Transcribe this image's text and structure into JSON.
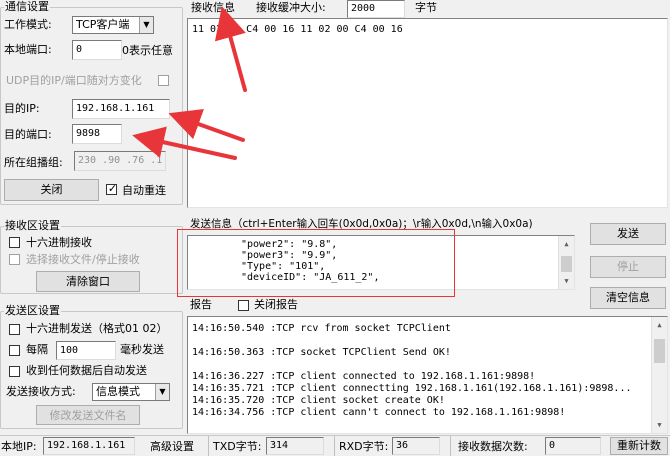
{
  "comm_settings": {
    "title": "通信设置",
    "work_mode_label": "工作模式:",
    "work_mode_value": "TCP客户端",
    "local_port_label": "本地端口:",
    "local_port_value": "0",
    "local_port_hint": "0表示任意",
    "udp_follow_label": "UDP目的IP/端口随对方变化",
    "dest_ip_label": "目的IP:",
    "dest_ip_value": "192.168.1.161",
    "dest_port_label": "目的端口:",
    "dest_port_value": "9898",
    "multicast_label": "所在组播组:",
    "multicast_value": "230 .90 .76 .1",
    "close_button": "关闭",
    "auto_reconnect_label": "自动重连",
    "auto_reconnect_checked": true
  },
  "receive_area": {
    "title": "接收区设置",
    "hex_receive_label": "十六进制接收",
    "select_file_label": "选择接收文件/停止接收",
    "clear_window_button": "清除窗口"
  },
  "send_area": {
    "title": "发送区设置",
    "hex_send_label": "十六进制发送（格式01 02）",
    "every_label": "每隔",
    "interval_value": "100",
    "ms_send_label": "毫秒发送",
    "auto_send_on_receive_label": "收到任何数据后自动发送",
    "send_receive_mode_label": "发送接收方式:",
    "send_receive_mode_value": "信息模式",
    "modify_filename_button": "修改发送文件名"
  },
  "receive_info": {
    "title": "接收信息",
    "buffer_label": "接收缓冲大小:",
    "buffer_value": "2000",
    "buffer_unit": "字节",
    "content": "11 02 00 C4 00 16 11 02 00 C4 00 16"
  },
  "send_info": {
    "title": "发送信息（ctrl+Enter输入回车(0x0d,0x0a)；\\r输入0x0d,\\n输入0x0a)",
    "lines": [
      "\"power2\": \"9.8\",",
      "\"power3\": \"9.9\",",
      "\"Type\": \"101\",",
      "\"deviceID\": \"JA_611_2\","
    ],
    "send_button": "发送",
    "stop_button": "停止",
    "clear_info_button": "清空信息"
  },
  "report": {
    "title": "报告",
    "close_report_label": "关闭报告",
    "lines": [
      "14:16:50.540 :TCP rcv from socket TCPClient",
      "",
      "14:16:50.363 :TCP socket TCPClient Send OK!",
      "",
      "14:16:36.227 :TCP client connected to 192.168.1.161:9898!",
      "14:16:35.721 :TCP client connectting 192.168.1.161(192.168.1.161):9898...",
      "14:16:35.720 :TCP client socket create OK!",
      "14:16:34.756 :TCP client cann't connect to 192.168.1.161:9898!"
    ]
  },
  "status_bar": {
    "local_ip_label": "本地IP:",
    "local_ip_value": "192.168.1.161",
    "advanced_settings_button": "高级设置",
    "txd_label": "TXD字节:",
    "txd_value": "314",
    "rxd_label": "RXD字节:",
    "rxd_value": "36",
    "receive_count_label": "接收数据次数:",
    "receive_count_value": "0",
    "recount_button": "重新计数"
  },
  "colors": {
    "annotation_red": "#e8353a",
    "window_bg": "#f0f0f0"
  }
}
